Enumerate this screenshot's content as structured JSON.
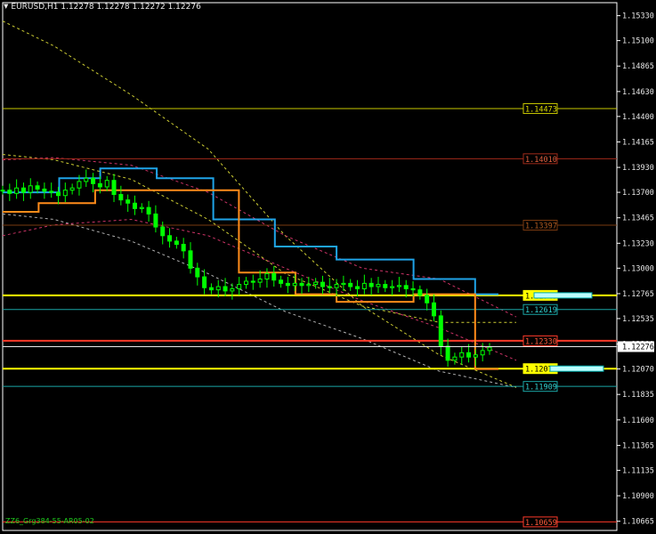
{
  "header": {
    "menu_arrow_icon": "triangle-down-icon",
    "text": "EURUSD,H1  1.12278 1.12278 1.12272 1.12276"
  },
  "footer": {
    "text": "ZZ6_Grg384-55-AR05-02"
  },
  "colors": {
    "background": "#000000",
    "grid_frame": "#ffffff",
    "candle": "#00ff00",
    "bid_line": "#e6e6e6",
    "blue_band": "#1fa4e8",
    "orange_band": "#ff8c1a"
  },
  "chart_data": {
    "type": "candlestick",
    "symbol": "EURUSD",
    "timeframe": "H1",
    "ohlc_last": {
      "open": 1.12278,
      "high": 1.12278,
      "low": 1.12272,
      "close": 1.12276
    },
    "ylim": [
      1.1058,
      1.1545
    ],
    "y_ticks": [
      "1.15330",
      "1.15100",
      "1.14865",
      "1.14630",
      "1.14400",
      "1.14165",
      "1.13930",
      "1.13700",
      "1.13465",
      "1.13230",
      "1.13000",
      "1.12765",
      "1.12535",
      "1.12300",
      "1.12070",
      "1.11835",
      "1.11600",
      "1.11365",
      "1.11135",
      "1.10900",
      "1.10665"
    ],
    "current_price": "1.12276",
    "levels": [
      {
        "price": 1.14473,
        "label": "1.14473",
        "color": "#c8c800",
        "label_bg": "#000000",
        "label_fg": "#dddd00",
        "width": 1,
        "tag": "level-14473"
      },
      {
        "price": 1.1401,
        "label": "1.14010",
        "color": "#a02a1a",
        "label_bg": "#000000",
        "label_fg": "#e06040",
        "width": 1,
        "tag": "level-14010"
      },
      {
        "price": 1.13397,
        "label": "1.13397",
        "color": "#7a3a10",
        "label_bg": "#000000",
        "label_fg": "#b05a20",
        "width": 1,
        "tag": "level-13397"
      },
      {
        "price": 1.12749,
        "label": "1.12749",
        "color": "#ffff00",
        "label_bg": "#ffff00",
        "label_fg": "#000000",
        "width": 2,
        "tag": "level-12749"
      },
      {
        "price": 1.12619,
        "label": "1.12619",
        "color": "#1aa6a6",
        "label_bg": "#000000",
        "label_fg": "#30d0d0",
        "width": 1,
        "tag": "level-12619"
      },
      {
        "price": 1.1233,
        "label": "1.12330",
        "color": "#ff3a2a",
        "label_bg": "#000000",
        "label_fg": "#ff5a3a",
        "width": 2,
        "tag": "level-12330"
      },
      {
        "price": 1.12073,
        "label": "1.12073",
        "color": "#ffff00",
        "label_bg": "#ffff00",
        "label_fg": "#000000",
        "width": 2,
        "tag": "level-12073"
      },
      {
        "price": 1.11909,
        "label": "1.11909",
        "color": "#1aa6a6",
        "label_bg": "#000000",
        "label_fg": "#30d0d0",
        "width": 1,
        "tag": "level-11909"
      },
      {
        "price": 1.10659,
        "label": "1.10659",
        "color": "#ff3a2a",
        "label_bg": "#000000",
        "label_fg": "#ff5a3a",
        "width": 1,
        "tag": "level-10659"
      }
    ],
    "close_series": [
      1.1372,
      1.1369,
      1.1374,
      1.137,
      1.1376,
      1.1373,
      1.1371,
      1.137,
      1.1367,
      1.1372,
      1.1374,
      1.138,
      1.1383,
      1.1378,
      1.1375,
      1.1381,
      1.1368,
      1.1363,
      1.136,
      1.1355,
      1.1356,
      1.135,
      1.1338,
      1.133,
      1.1325,
      1.1322,
      1.1316,
      1.13,
      1.1292,
      1.1282,
      1.128,
      1.1283,
      1.1279,
      1.1281,
      1.1285,
      1.1288,
      1.1287,
      1.129,
      1.1295,
      1.1289,
      1.1286,
      1.1284,
      1.1286,
      1.1284,
      1.1285,
      1.1287,
      1.1283,
      1.1282,
      1.1285,
      1.1286,
      1.1283,
      1.1281,
      1.1286,
      1.1283,
      1.1285,
      1.1282,
      1.1283,
      1.1284,
      1.1281,
      1.128,
      1.1275,
      1.1268,
      1.1256,
      1.1228,
      1.1215,
      1.1218,
      1.1222,
      1.1218,
      1.122,
      1.1224,
      1.1227
    ],
    "blue_steps": [
      [
        1.137,
        0
      ],
      [
        1.1383,
        11
      ],
      [
        1.1392,
        19
      ],
      [
        1.1383,
        30
      ],
      [
        1.1345,
        41
      ],
      [
        1.132,
        53
      ],
      [
        1.1308,
        65
      ],
      [
        1.129,
        80
      ],
      [
        1.1276,
        92
      ]
    ],
    "orange_steps": [
      [
        1.1352,
        0
      ],
      [
        1.136,
        7
      ],
      [
        1.1372,
        18
      ],
      [
        1.1372,
        35
      ],
      [
        1.1296,
        46
      ],
      [
        1.1276,
        57
      ],
      [
        1.1269,
        65
      ],
      [
        1.1276,
        80
      ],
      [
        1.1207,
        92
      ]
    ],
    "dashed_curves": [
      {
        "color": "#cccc33",
        "points": [
          [
            0,
            1.1528
          ],
          [
            10,
            1.1505
          ],
          [
            25,
            1.146
          ],
          [
            40,
            1.141
          ],
          [
            55,
            1.133
          ],
          [
            70,
            1.1265
          ],
          [
            85,
            1.122
          ],
          [
            100,
            1.119
          ]
        ]
      },
      {
        "color": "#cccc33",
        "points": [
          [
            0,
            1.1405
          ],
          [
            10,
            1.14
          ],
          [
            25,
            1.1382
          ],
          [
            40,
            1.1345
          ],
          [
            55,
            1.1295
          ],
          [
            70,
            1.1265
          ],
          [
            85,
            1.125
          ],
          [
            100,
            1.125
          ]
        ]
      },
      {
        "color": "#b0b0b0",
        "points": [
          [
            0,
            1.135
          ],
          [
            10,
            1.1345
          ],
          [
            25,
            1.1325
          ],
          [
            40,
            1.1295
          ],
          [
            55,
            1.126
          ],
          [
            70,
            1.1235
          ],
          [
            85,
            1.1205
          ],
          [
            100,
            1.119
          ]
        ]
      },
      {
        "color": "#cc3366",
        "points": [
          [
            0,
            1.14
          ],
          [
            10,
            1.1402
          ],
          [
            25,
            1.1395
          ],
          [
            40,
            1.137
          ],
          [
            55,
            1.133
          ],
          [
            70,
            1.13
          ],
          [
            85,
            1.129
          ],
          [
            100,
            1.1255
          ]
        ]
      },
      {
        "color": "#cc3366",
        "points": [
          [
            0,
            1.133
          ],
          [
            10,
            1.134
          ],
          [
            25,
            1.1345
          ],
          [
            40,
            1.133
          ],
          [
            55,
            1.13
          ],
          [
            70,
            1.127
          ],
          [
            85,
            1.1245
          ],
          [
            100,
            1.1215
          ]
        ]
      }
    ]
  }
}
